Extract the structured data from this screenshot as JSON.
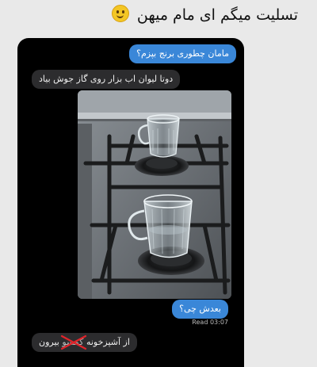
{
  "post": {
    "caption": "تسلیت میگم ای مام میهن",
    "emoji_icon": "slightly-smiling-face-icon"
  },
  "chat": {
    "messages": [
      {
        "id": "m1",
        "direction": "outgoing",
        "text": "مامان چطوری برنج بپزم؟"
      },
      {
        "id": "m2",
        "direction": "incoming",
        "text": "دوتا لیوان اب بزار روی گاز جوش بیاد"
      },
      {
        "id": "m3",
        "direction": "outgoing",
        "text": "بعدش چی؟"
      },
      {
        "id": "m4",
        "direction": "incoming",
        "text_before": "از آشپزخونه",
        "struck_word": "گمشو",
        "text_after": "بیرون"
      }
    ],
    "timestamp": "Read 03:07",
    "photo": {
      "description_icon": "photo-two-glasses-on-stove-icon"
    }
  },
  "colors": {
    "background": "#e9e9e9",
    "chat_background": "#000000",
    "outgoing_bubble": "#3a87d8",
    "incoming_bubble": "#2c2c2e",
    "strike_mark": "#e0242a"
  }
}
